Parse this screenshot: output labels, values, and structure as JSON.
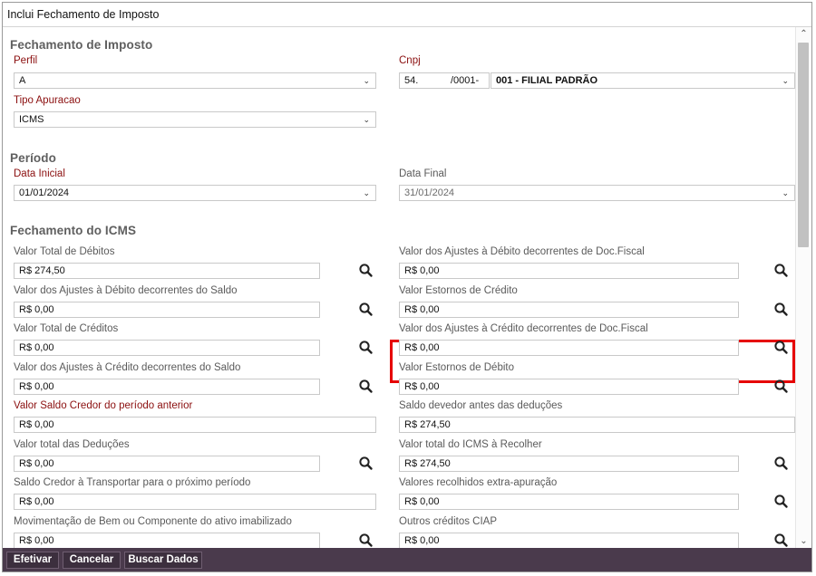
{
  "window": {
    "title": "Inclui Fechamento de Imposto"
  },
  "sections": {
    "fechamento": "Fechamento de Imposto",
    "periodo": "Período",
    "icms": "Fechamento do ICMS"
  },
  "perfil": {
    "label": "Perfil",
    "value": "A"
  },
  "cnpj": {
    "label": "Cnpj",
    "part1": "54.",
    "part2": "/0001-",
    "filial": "001 - FILIAL PADRÃO"
  },
  "tipo": {
    "label": "Tipo Apuracao",
    "value": "ICMS"
  },
  "data_inicial": {
    "label": "Data Inicial",
    "value": "01/01/2024"
  },
  "data_final": {
    "label": "Data Final",
    "value": "31/01/2024"
  },
  "icms_left": [
    {
      "label": "Valor Total de Débitos",
      "value": "R$ 274,50"
    },
    {
      "label": "Valor dos Ajustes à Débito decorrentes do Saldo",
      "value": "R$ 0,00"
    },
    {
      "label": "Valor Total de Créditos",
      "value": "R$ 0,00"
    },
    {
      "label": "Valor dos Ajustes à Crédito decorrentes do Saldo",
      "value": "R$ 0,00"
    },
    {
      "label": "Valor Saldo Credor do período anterior",
      "value": "R$ 0,00"
    },
    {
      "label": "Valor total das Deduções",
      "value": "R$ 0,00"
    },
    {
      "label": "Saldo Credor à Transportar para o próximo período",
      "value": "R$ 0,00"
    },
    {
      "label": "Movimentação de Bem ou Componente do ativo imabilizado",
      "value": "R$ 0,00"
    }
  ],
  "icms_right": [
    {
      "label": "Valor dos Ajustes à Débito decorrentes de Doc.Fiscal",
      "value": "R$ 0,00"
    },
    {
      "label": "Valor Estornos de Crédito",
      "value": "R$ 0,00"
    },
    {
      "label": "Valor dos Ajustes à Crédito decorrentes de Doc.Fiscal",
      "value": "R$ 0,00"
    },
    {
      "label": "Valor Estornos de Débito",
      "value": "R$ 0,00"
    },
    {
      "label": "Saldo devedor antes das deduções",
      "value": "R$ 274,50"
    },
    {
      "label": "Valor total do ICMS à Recolher",
      "value": "R$ 274,50"
    },
    {
      "label": "Valores recolhidos extra-apuração",
      "value": "R$ 0,00"
    },
    {
      "label": "Outros créditos CIAP",
      "value": "R$ 0,00"
    }
  ],
  "buttons": {
    "efetivar": "Efetivar",
    "cancelar": "Cancelar",
    "buscar": "Buscar Dados"
  },
  "icons": {
    "search": "search-icon",
    "dropdown": "chevron-down-icon"
  },
  "colors": {
    "required_label": "#8b0f0f",
    "footer": "#4a3a4c",
    "highlight": "#e60000"
  }
}
